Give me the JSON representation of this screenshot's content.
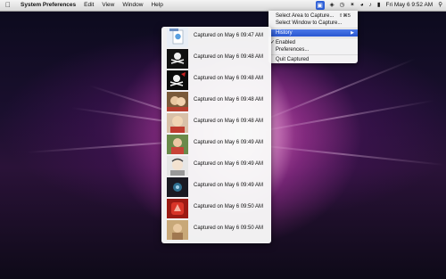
{
  "menubar": {
    "apple_icon": "apple-logo-icon",
    "app_name": "System Preferences",
    "items": [
      "Edit",
      "View",
      "Window",
      "Help"
    ],
    "status_icons": [
      "capture-app-icon",
      "dropbox-icon",
      "timemachine-icon",
      "bluetooth-icon",
      "wifi-icon",
      "volume-icon",
      "battery-icon"
    ],
    "clock": "Fri May 6  9:52 AM",
    "search_icon": "spotlight-icon"
  },
  "capture_menu": {
    "items": [
      {
        "label": "Select Area to Capture...",
        "shortcut": "⇧⌘5",
        "checked": false,
        "highlighted": false
      },
      {
        "label": "Select Window to Capture...",
        "shortcut": "",
        "checked": false,
        "highlighted": false
      },
      {
        "label": "History",
        "shortcut": "",
        "checked": false,
        "highlighted": true,
        "submenu": true
      },
      {
        "label": "Enabled",
        "shortcut": "",
        "checked": true,
        "highlighted": false
      },
      {
        "label": "Preferences...",
        "shortcut": "",
        "checked": false,
        "highlighted": false
      },
      {
        "label": "Quit Captured",
        "shortcut": "",
        "checked": false,
        "highlighted": false
      }
    ],
    "check_mark": "✓",
    "submenu_arrow": "▶"
  },
  "history": {
    "items": [
      {
        "label": "Captured on May 6 09:47 AM",
        "thumb": "document-icon-thumb"
      },
      {
        "label": "Captured on May 6 09:48 AM",
        "thumb": "pirate-flag-thumb"
      },
      {
        "label": "Captured on May 6 09:48 AM",
        "thumb": "pirate-flag-thumb"
      },
      {
        "label": "Captured on May 6 09:48 AM",
        "thumb": "person-photo-thumb"
      },
      {
        "label": "Captured on May 6 09:48 AM",
        "thumb": "person-photo-thumb"
      },
      {
        "label": "Captured on May 6 09:49 AM",
        "thumb": "person-photo-thumb"
      },
      {
        "label": "Captured on May 6 09:49 AM",
        "thumb": "person-photo-thumb"
      },
      {
        "label": "Captured on May 6 09:49 AM",
        "thumb": "dark-icon-thumb"
      },
      {
        "label": "Captured on May 6 09:50 AM",
        "thumb": "red-app-icon-thumb"
      },
      {
        "label": "Captured on May 6 09:50 AM",
        "thumb": "portrait-photo-thumb"
      }
    ]
  }
}
